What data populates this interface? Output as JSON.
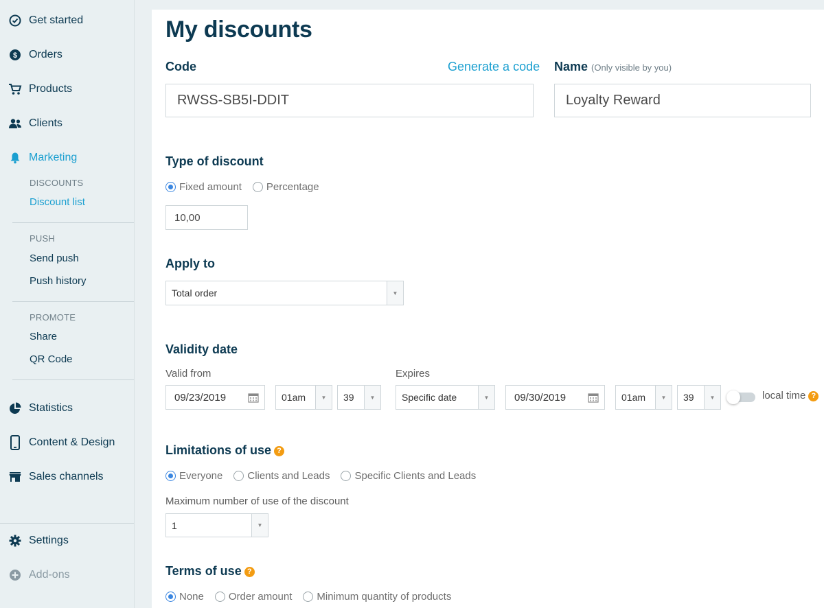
{
  "sidebar": {
    "items": [
      {
        "label": "Get started",
        "icon": "check-circle-icon"
      },
      {
        "label": "Orders",
        "icon": "dollar-circle-icon"
      },
      {
        "label": "Products",
        "icon": "cart-icon"
      },
      {
        "label": "Clients",
        "icon": "users-icon"
      },
      {
        "label": "Marketing",
        "icon": "bell-icon"
      },
      {
        "label": "Statistics",
        "icon": "pie-chart-icon"
      },
      {
        "label": "Content & Design",
        "icon": "phone-icon"
      },
      {
        "label": "Sales channels",
        "icon": "store-icon"
      },
      {
        "label": "Settings",
        "icon": "gear-icon"
      },
      {
        "label": "Add-ons",
        "icon": "plus-circle-icon"
      }
    ],
    "marketing": {
      "discounts_heading": "DISCOUNTS",
      "discount_list": "Discount list",
      "push_heading": "PUSH",
      "send_push": "Send push",
      "push_history": "Push history",
      "promote_heading": "PROMOTE",
      "share": "Share",
      "qr_code": "QR Code"
    }
  },
  "page": {
    "title": "My discounts",
    "code_label": "Code",
    "generate_link": "Generate a code",
    "code_value": "RWSS-SB5I-DDIT",
    "name_label": "Name",
    "name_note": "(Only visible by you)",
    "name_value": "Loyalty Reward",
    "type_title": "Type of discount",
    "type_fixed": "Fixed amount",
    "type_percentage": "Percentage",
    "amount_value": "10,00",
    "apply_title": "Apply to",
    "apply_value": "Total order",
    "validity_title": "Validity date",
    "valid_from_label": "Valid from",
    "valid_from_date": "09/23/2019",
    "valid_from_hour": "01am",
    "valid_from_min": "39",
    "expires_label": "Expires",
    "expires_mode": "Specific date",
    "expires_date": "09/30/2019",
    "expires_hour": "01am",
    "expires_min": "39",
    "local_time": "local time",
    "limitations_title": "Limitations of use",
    "lim_everyone": "Everyone",
    "lim_clients": "Clients and Leads",
    "lim_specific": "Specific Clients and Leads",
    "max_use_label": "Maximum number of use of the discount",
    "max_use_value": "1",
    "terms_title": "Terms of use",
    "terms_none": "None",
    "terms_order_amount": "Order amount",
    "terms_min_qty": "Minimum quantity of products",
    "help_glyph": "?"
  },
  "colors": {
    "navy": "#0d3a52",
    "accent": "#1a9fd0",
    "radio_on": "#3a86e0",
    "help": "#f39c12"
  }
}
